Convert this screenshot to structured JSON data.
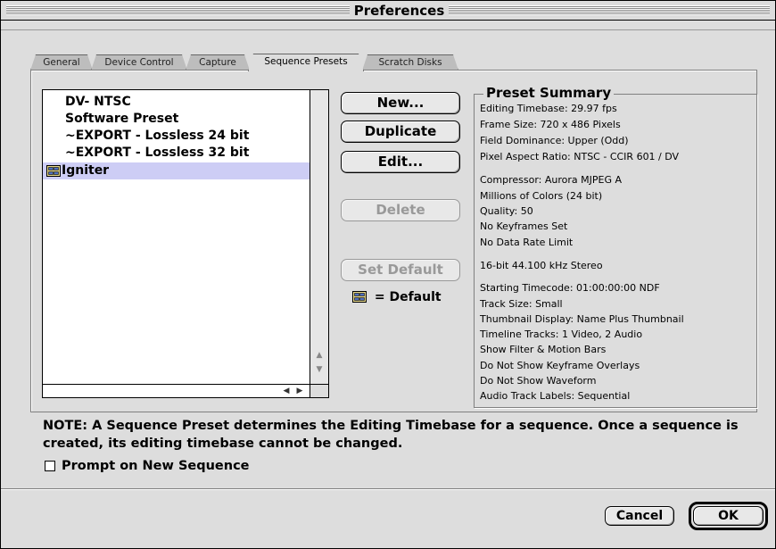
{
  "window": {
    "title": "Preferences"
  },
  "tabs": [
    {
      "label": "General",
      "active": false
    },
    {
      "label": "Device Control",
      "active": false
    },
    {
      "label": "Capture",
      "active": false
    },
    {
      "label": "Sequence Presets",
      "active": true
    },
    {
      "label": "Scratch Disks",
      "active": false
    }
  ],
  "presets_list": {
    "items": [
      {
        "label": "DV- NTSC",
        "is_default": false,
        "selected": false
      },
      {
        "label": "Software Preset",
        "is_default": false,
        "selected": false
      },
      {
        "label": "~EXPORT - Lossless 24 bit",
        "is_default": false,
        "selected": false
      },
      {
        "label": "~EXPORT - Lossless 32 bit",
        "is_default": false,
        "selected": false
      },
      {
        "label": "Igniter",
        "is_default": true,
        "selected": true
      }
    ],
    "selection_color": "#cdcdf5"
  },
  "buttons": {
    "new": "New...",
    "duplicate": "Duplicate",
    "edit": "Edit...",
    "delete": "Delete",
    "set_default": "Set Default",
    "default_legend": "= Default"
  },
  "summary": {
    "title": "Preset Summary",
    "lines": [
      "Editing Timebase: 29.97 fps",
      "Frame Size: 720 x 486 Pixels",
      "Field Dominance: Upper (Odd)",
      "Pixel Aspect Ratio: NTSC - CCIR 601 / DV",
      "Compressor: Aurora MJPEG A",
      "Millions of Colors (24 bit)",
      "Quality: 50",
      "No Keyframes Set",
      "No Data Rate Limit",
      "16-bit 44.100 kHz Stereo",
      "Starting Timecode: 01:00:00:00 NDF",
      "Track Size: Small",
      "Thumbnail Display: Name Plus Thumbnail",
      "Timeline Tracks: 1 Video, 2 Audio",
      "Show Filter & Motion Bars",
      "Do Not Show Keyframe Overlays",
      "Do Not Show Waveform",
      "Audio Track Labels: Sequential"
    ]
  },
  "note": "NOTE: A Sequence Preset determines the Editing Timebase for a sequence. Once a sequence is created, its editing timebase cannot be changed.",
  "prompt_checkbox": {
    "label": "Prompt on New Sequence",
    "checked": false
  },
  "footer": {
    "cancel": "Cancel",
    "ok": "OK"
  }
}
